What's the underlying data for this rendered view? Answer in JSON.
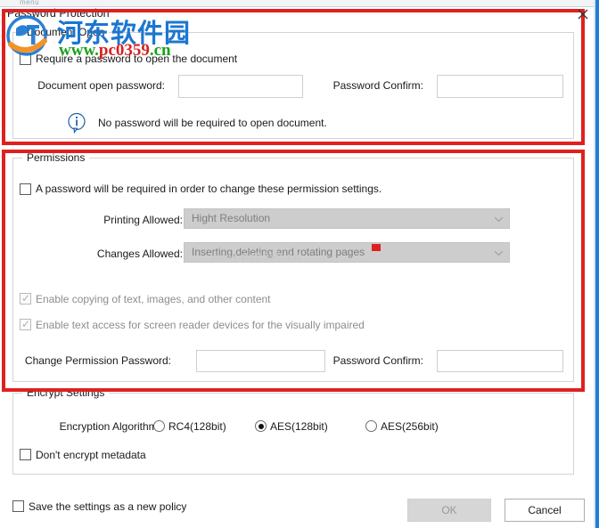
{
  "window": {
    "title": "Password Protection",
    "top_strip_label": "menu",
    "close_icon": "close-x-icon",
    "frame_color": "#1f7fd4"
  },
  "watermark": {
    "site_name_cn": "河东软件园",
    "site_url_green": "www.",
    "site_url_red": "pc0359",
    "site_url_tail": ".cn",
    "faint_url": "www.pc0359.cn",
    "logo_icon": "site-logo-icon",
    "color_blue": "#1b76d1",
    "color_green": "#18a318",
    "color_red": "#d62020"
  },
  "document_open": {
    "group_title": "Document Open",
    "require_password": {
      "label": "Require a password to open the document",
      "checked": false
    },
    "open_password": {
      "label": "Document open password:",
      "value": "",
      "placeholder": ""
    },
    "password_confirm": {
      "label": "Password Confirm:",
      "value": "",
      "placeholder": ""
    },
    "info": {
      "icon": "info-bubble-icon",
      "text": "No password will be required to open document."
    }
  },
  "permissions": {
    "group_title": "Permissions",
    "require_password": {
      "label": "A password will be required in order to change these permission settings.",
      "checked": false
    },
    "printing_allowed": {
      "label": "Printing Allowed:",
      "value": "Hight Resolution",
      "disabled": true
    },
    "changes_allowed": {
      "label": "Changes Allowed:",
      "value": "Inserting,deleting and rotating pages",
      "disabled": true
    },
    "enable_copy": {
      "label": "Enable copying of text, images, and other content",
      "checked": true,
      "disabled": true
    },
    "enable_screen_reader": {
      "label": "Enable text access for screen reader devices for the visually impaired",
      "checked": true,
      "disabled": true
    },
    "change_permission_password": {
      "label": "Change Permission Password:",
      "value": "",
      "placeholder": ""
    },
    "password_confirm": {
      "label": "Password Confirm:",
      "value": "",
      "placeholder": ""
    }
  },
  "encrypt_settings": {
    "group_title": "Encrypt Settings",
    "algorithm_label": "Encryption Algorithm:",
    "options": [
      {
        "label": "RC4(128bit)",
        "selected": false
      },
      {
        "label": "AES(128bit)",
        "selected": true
      },
      {
        "label": "AES(256bit)",
        "selected": false
      }
    ],
    "dont_encrypt_metadata": {
      "label": "Don't encrypt metadata",
      "checked": false
    }
  },
  "footer": {
    "save_policy": {
      "label": "Save the settings as a new policy",
      "checked": false
    },
    "ok_label": "OK",
    "ok_disabled": true,
    "cancel_label": "Cancel"
  },
  "annotations": {
    "highlight_color": "#e02020",
    "boxes": [
      {
        "name": "document-open-highlight"
      },
      {
        "name": "permissions-highlight"
      }
    ],
    "marker": "red-square-marker"
  }
}
